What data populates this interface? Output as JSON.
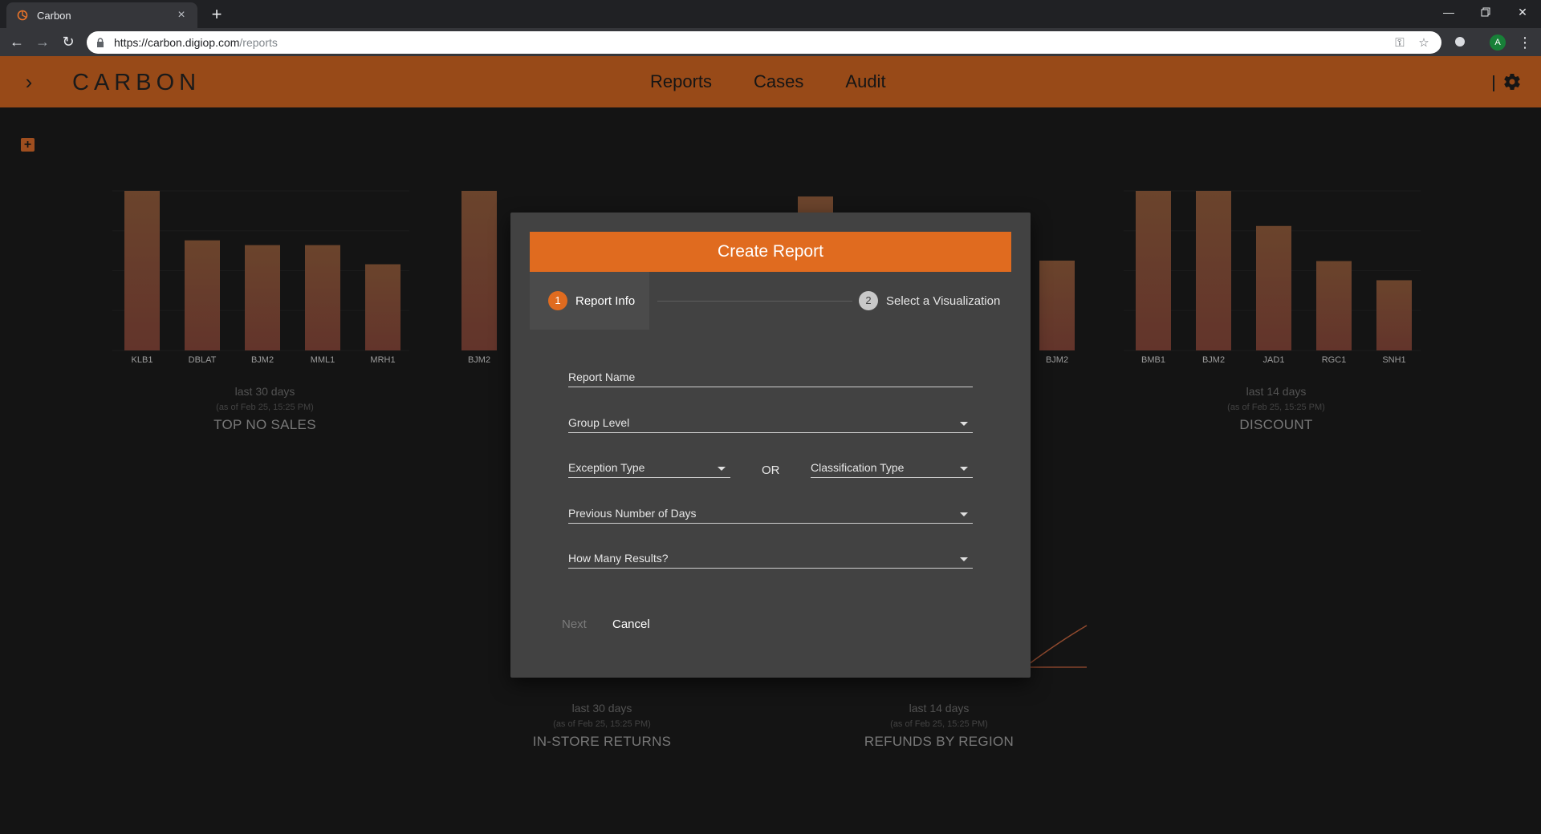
{
  "browser": {
    "tab_title": "Carbon",
    "tab_close": "×",
    "new_tab": "+",
    "url_host": "https://carbon.digiop.com",
    "url_path": "/reports",
    "profile_initial": "A"
  },
  "header": {
    "brand": "CARBON",
    "nav": [
      "Reports",
      "Cases",
      "Audit"
    ]
  },
  "widgets": {
    "top_no_sales": {
      "period": "last 30 days",
      "as_of": "(as of Feb 25, 15:25 PM)",
      "name": "TOP NO SALES"
    },
    "discount": {
      "period": "last 14 days",
      "as_of": "(as of Feb 25, 15:25 PM)",
      "name": "DISCOUNT"
    },
    "in_store_returns": {
      "period": "last 30 days",
      "as_of": "(as of Feb 25, 15:25 PM)",
      "name": "IN-STORE RETURNS"
    },
    "refunds_by_region": {
      "period": "last 14 days",
      "as_of": "(as of Feb 25, 15:25 PM)",
      "name": "REFUNDS BY REGION"
    },
    "partial_left_label": "BJM2",
    "partial_right_label": "BJM2"
  },
  "chart_data": [
    {
      "type": "bar",
      "title": "TOP NO SALES",
      "categories": [
        "KLB1",
        "DBLAT",
        "BJM2",
        "MML1",
        "MRH1"
      ],
      "values": [
        100,
        69,
        66,
        66,
        54
      ],
      "ylim": [
        0,
        100
      ]
    },
    {
      "type": "bar",
      "title": "DISCOUNT",
      "categories": [
        "BMB1",
        "BJM2",
        "JAD1",
        "RGC1",
        "SNH1"
      ],
      "values": [
        100,
        100,
        78,
        56,
        44
      ],
      "ylim": [
        0,
        100
      ]
    }
  ],
  "modal": {
    "title": "Create Report",
    "steps": [
      {
        "num": "1",
        "label": "Report Info"
      },
      {
        "num": "2",
        "label": "Select a Visualization"
      }
    ],
    "fields": {
      "report_name": "Report Name",
      "group_level": "Group Level",
      "exception_type": "Exception Type",
      "or": "OR",
      "classification_type": "Classification Type",
      "previous_days": "Previous Number of Days",
      "how_many": "How Many Results?"
    },
    "buttons": {
      "next": "Next",
      "cancel": "Cancel"
    }
  },
  "colors": {
    "header": "#984a18",
    "accent": "#e06b1f",
    "bar_top": "#8f5a3a",
    "bar_bottom": "#8a4a3c"
  }
}
